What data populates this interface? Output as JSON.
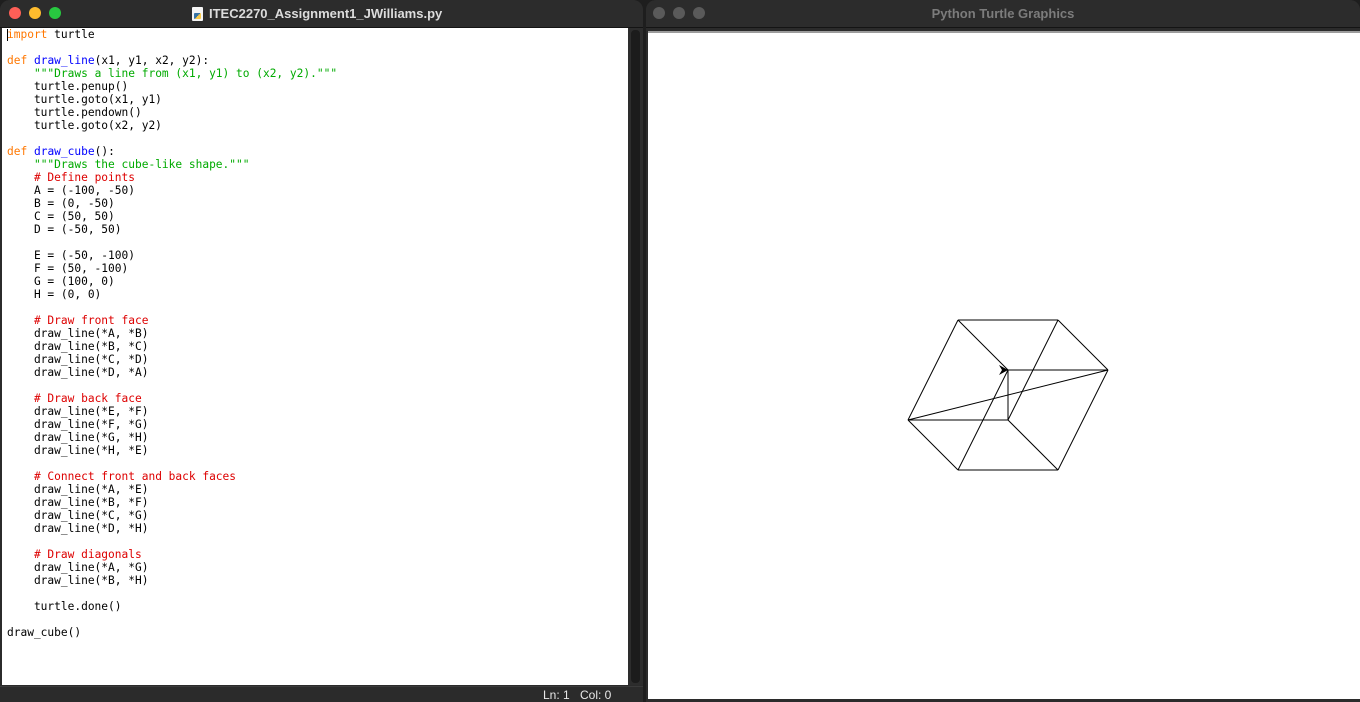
{
  "editor": {
    "title": "ITEC2270_Assignment1_JWilliams.py",
    "status": {
      "ln": "Ln: 1",
      "col": "Col: 0"
    },
    "code_lines": [
      [
        {
          "t": "import",
          "c": "kw"
        },
        {
          "t": " turtle"
        }
      ],
      [],
      [
        {
          "t": "def",
          "c": "kw"
        },
        {
          "t": " "
        },
        {
          "t": "draw_line",
          "c": "fn"
        },
        {
          "t": "(x1, y1, x2, y2):"
        }
      ],
      [
        {
          "t": "    "
        },
        {
          "t": "\"\"\"Draws a line from (x1, y1) to (x2, y2).\"\"\"",
          "c": "str"
        }
      ],
      [
        {
          "t": "    turtle.penup()"
        }
      ],
      [
        {
          "t": "    turtle.goto(x1, y1)"
        }
      ],
      [
        {
          "t": "    turtle.pendown()"
        }
      ],
      [
        {
          "t": "    turtle.goto(x2, y2)"
        }
      ],
      [],
      [
        {
          "t": "def",
          "c": "kw"
        },
        {
          "t": " "
        },
        {
          "t": "draw_cube",
          "c": "fn"
        },
        {
          "t": "():"
        }
      ],
      [
        {
          "t": "    "
        },
        {
          "t": "\"\"\"Draws the cube-like shape.\"\"\"",
          "c": "str"
        }
      ],
      [
        {
          "t": "    "
        },
        {
          "t": "# Define points",
          "c": "cm"
        }
      ],
      [
        {
          "t": "    A = (-100, -50)"
        }
      ],
      [
        {
          "t": "    B = (0, -50)"
        }
      ],
      [
        {
          "t": "    C = (50, 50)"
        }
      ],
      [
        {
          "t": "    D = (-50, 50)"
        }
      ],
      [],
      [
        {
          "t": "    E = (-50, -100)"
        }
      ],
      [
        {
          "t": "    F = (50, -100)"
        }
      ],
      [
        {
          "t": "    G = (100, 0)"
        }
      ],
      [
        {
          "t": "    H = (0, 0)"
        }
      ],
      [],
      [
        {
          "t": "    "
        },
        {
          "t": "# Draw front face",
          "c": "cm"
        }
      ],
      [
        {
          "t": "    draw_line(*A, *B)"
        }
      ],
      [
        {
          "t": "    draw_line(*B, *C)"
        }
      ],
      [
        {
          "t": "    draw_line(*C, *D)"
        }
      ],
      [
        {
          "t": "    draw_line(*D, *A)"
        }
      ],
      [],
      [
        {
          "t": "    "
        },
        {
          "t": "# Draw back face",
          "c": "cm"
        }
      ],
      [
        {
          "t": "    draw_line(*E, *F)"
        }
      ],
      [
        {
          "t": "    draw_line(*F, *G)"
        }
      ],
      [
        {
          "t": "    draw_line(*G, *H)"
        }
      ],
      [
        {
          "t": "    draw_line(*H, *E)"
        }
      ],
      [],
      [
        {
          "t": "    "
        },
        {
          "t": "# Connect front and back faces",
          "c": "cm"
        }
      ],
      [
        {
          "t": "    draw_line(*A, *E)"
        }
      ],
      [
        {
          "t": "    draw_line(*B, *F)"
        }
      ],
      [
        {
          "t": "    draw_line(*C, *G)"
        }
      ],
      [
        {
          "t": "    draw_line(*D, *H)"
        }
      ],
      [],
      [
        {
          "t": "    "
        },
        {
          "t": "# Draw diagonals",
          "c": "cm"
        }
      ],
      [
        {
          "t": "    draw_line(*A, *G)"
        }
      ],
      [
        {
          "t": "    draw_line(*B, *H)"
        }
      ],
      [],
      [
        {
          "t": "    turtle.done()"
        }
      ],
      [],
      [
        {
          "t": "draw_cube()"
        }
      ]
    ]
  },
  "turtle_window": {
    "title": "Python Turtle Graphics",
    "points": {
      "A": [
        -100,
        -50
      ],
      "B": [
        0,
        -50
      ],
      "C": [
        50,
        50
      ],
      "D": [
        -50,
        50
      ],
      "E": [
        -50,
        -100
      ],
      "F": [
        50,
        -100
      ],
      "G": [
        100,
        0
      ],
      "H": [
        0,
        0
      ]
    },
    "lines": [
      [
        "A",
        "B"
      ],
      [
        "B",
        "C"
      ],
      [
        "C",
        "D"
      ],
      [
        "D",
        "A"
      ],
      [
        "E",
        "F"
      ],
      [
        "F",
        "G"
      ],
      [
        "G",
        "H"
      ],
      [
        "H",
        "E"
      ],
      [
        "A",
        "E"
      ],
      [
        "B",
        "F"
      ],
      [
        "C",
        "G"
      ],
      [
        "D",
        "H"
      ],
      [
        "A",
        "G"
      ],
      [
        "B",
        "H"
      ]
    ],
    "turtle_position": [
      0,
      0
    ]
  },
  "colors": {
    "close": "#fe5f57",
    "minimize": "#febc2e",
    "zoom": "#28c840",
    "keyword": "#ff7700",
    "function_name": "#0000ff",
    "string": "#00aa00",
    "comment": "#dd0000"
  }
}
